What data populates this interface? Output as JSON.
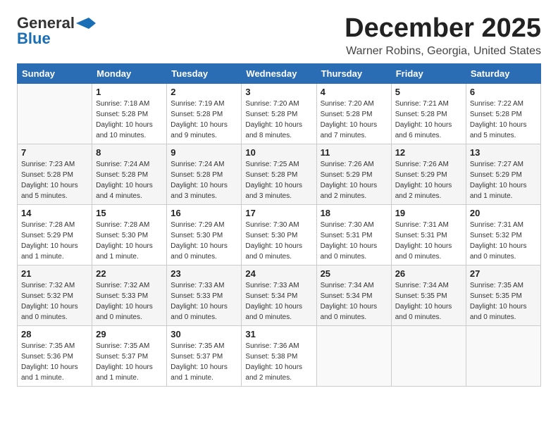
{
  "header": {
    "logo_general": "General",
    "logo_blue": "Blue",
    "month_title": "December 2025",
    "location": "Warner Robins, Georgia, United States"
  },
  "calendar": {
    "days_of_week": [
      "Sunday",
      "Monday",
      "Tuesday",
      "Wednesday",
      "Thursday",
      "Friday",
      "Saturday"
    ],
    "weeks": [
      [
        {
          "date": "",
          "info": ""
        },
        {
          "date": "1",
          "info": "Sunrise: 7:18 AM\nSunset: 5:28 PM\nDaylight: 10 hours\nand 10 minutes."
        },
        {
          "date": "2",
          "info": "Sunrise: 7:19 AM\nSunset: 5:28 PM\nDaylight: 10 hours\nand 9 minutes."
        },
        {
          "date": "3",
          "info": "Sunrise: 7:20 AM\nSunset: 5:28 PM\nDaylight: 10 hours\nand 8 minutes."
        },
        {
          "date": "4",
          "info": "Sunrise: 7:20 AM\nSunset: 5:28 PM\nDaylight: 10 hours\nand 7 minutes."
        },
        {
          "date": "5",
          "info": "Sunrise: 7:21 AM\nSunset: 5:28 PM\nDaylight: 10 hours\nand 6 minutes."
        },
        {
          "date": "6",
          "info": "Sunrise: 7:22 AM\nSunset: 5:28 PM\nDaylight: 10 hours\nand 5 minutes."
        }
      ],
      [
        {
          "date": "7",
          "info": "Sunrise: 7:23 AM\nSunset: 5:28 PM\nDaylight: 10 hours\nand 5 minutes."
        },
        {
          "date": "8",
          "info": "Sunrise: 7:24 AM\nSunset: 5:28 PM\nDaylight: 10 hours\nand 4 minutes."
        },
        {
          "date": "9",
          "info": "Sunrise: 7:24 AM\nSunset: 5:28 PM\nDaylight: 10 hours\nand 3 minutes."
        },
        {
          "date": "10",
          "info": "Sunrise: 7:25 AM\nSunset: 5:28 PM\nDaylight: 10 hours\nand 3 minutes."
        },
        {
          "date": "11",
          "info": "Sunrise: 7:26 AM\nSunset: 5:29 PM\nDaylight: 10 hours\nand 2 minutes."
        },
        {
          "date": "12",
          "info": "Sunrise: 7:26 AM\nSunset: 5:29 PM\nDaylight: 10 hours\nand 2 minutes."
        },
        {
          "date": "13",
          "info": "Sunrise: 7:27 AM\nSunset: 5:29 PM\nDaylight: 10 hours\nand 1 minute."
        }
      ],
      [
        {
          "date": "14",
          "info": "Sunrise: 7:28 AM\nSunset: 5:29 PM\nDaylight: 10 hours\nand 1 minute."
        },
        {
          "date": "15",
          "info": "Sunrise: 7:28 AM\nSunset: 5:30 PM\nDaylight: 10 hours\nand 1 minute."
        },
        {
          "date": "16",
          "info": "Sunrise: 7:29 AM\nSunset: 5:30 PM\nDaylight: 10 hours\nand 0 minutes."
        },
        {
          "date": "17",
          "info": "Sunrise: 7:30 AM\nSunset: 5:30 PM\nDaylight: 10 hours\nand 0 minutes."
        },
        {
          "date": "18",
          "info": "Sunrise: 7:30 AM\nSunset: 5:31 PM\nDaylight: 10 hours\nand 0 minutes."
        },
        {
          "date": "19",
          "info": "Sunrise: 7:31 AM\nSunset: 5:31 PM\nDaylight: 10 hours\nand 0 minutes."
        },
        {
          "date": "20",
          "info": "Sunrise: 7:31 AM\nSunset: 5:32 PM\nDaylight: 10 hours\nand 0 minutes."
        }
      ],
      [
        {
          "date": "21",
          "info": "Sunrise: 7:32 AM\nSunset: 5:32 PM\nDaylight: 10 hours\nand 0 minutes."
        },
        {
          "date": "22",
          "info": "Sunrise: 7:32 AM\nSunset: 5:33 PM\nDaylight: 10 hours\nand 0 minutes."
        },
        {
          "date": "23",
          "info": "Sunrise: 7:33 AM\nSunset: 5:33 PM\nDaylight: 10 hours\nand 0 minutes."
        },
        {
          "date": "24",
          "info": "Sunrise: 7:33 AM\nSunset: 5:34 PM\nDaylight: 10 hours\nand 0 minutes."
        },
        {
          "date": "25",
          "info": "Sunrise: 7:34 AM\nSunset: 5:34 PM\nDaylight: 10 hours\nand 0 minutes."
        },
        {
          "date": "26",
          "info": "Sunrise: 7:34 AM\nSunset: 5:35 PM\nDaylight: 10 hours\nand 0 minutes."
        },
        {
          "date": "27",
          "info": "Sunrise: 7:35 AM\nSunset: 5:35 PM\nDaylight: 10 hours\nand 0 minutes."
        }
      ],
      [
        {
          "date": "28",
          "info": "Sunrise: 7:35 AM\nSunset: 5:36 PM\nDaylight: 10 hours\nand 1 minute."
        },
        {
          "date": "29",
          "info": "Sunrise: 7:35 AM\nSunset: 5:37 PM\nDaylight: 10 hours\nand 1 minute."
        },
        {
          "date": "30",
          "info": "Sunrise: 7:35 AM\nSunset: 5:37 PM\nDaylight: 10 hours\nand 1 minute."
        },
        {
          "date": "31",
          "info": "Sunrise: 7:36 AM\nSunset: 5:38 PM\nDaylight: 10 hours\nand 2 minutes."
        },
        {
          "date": "",
          "info": ""
        },
        {
          "date": "",
          "info": ""
        },
        {
          "date": "",
          "info": ""
        }
      ]
    ]
  }
}
